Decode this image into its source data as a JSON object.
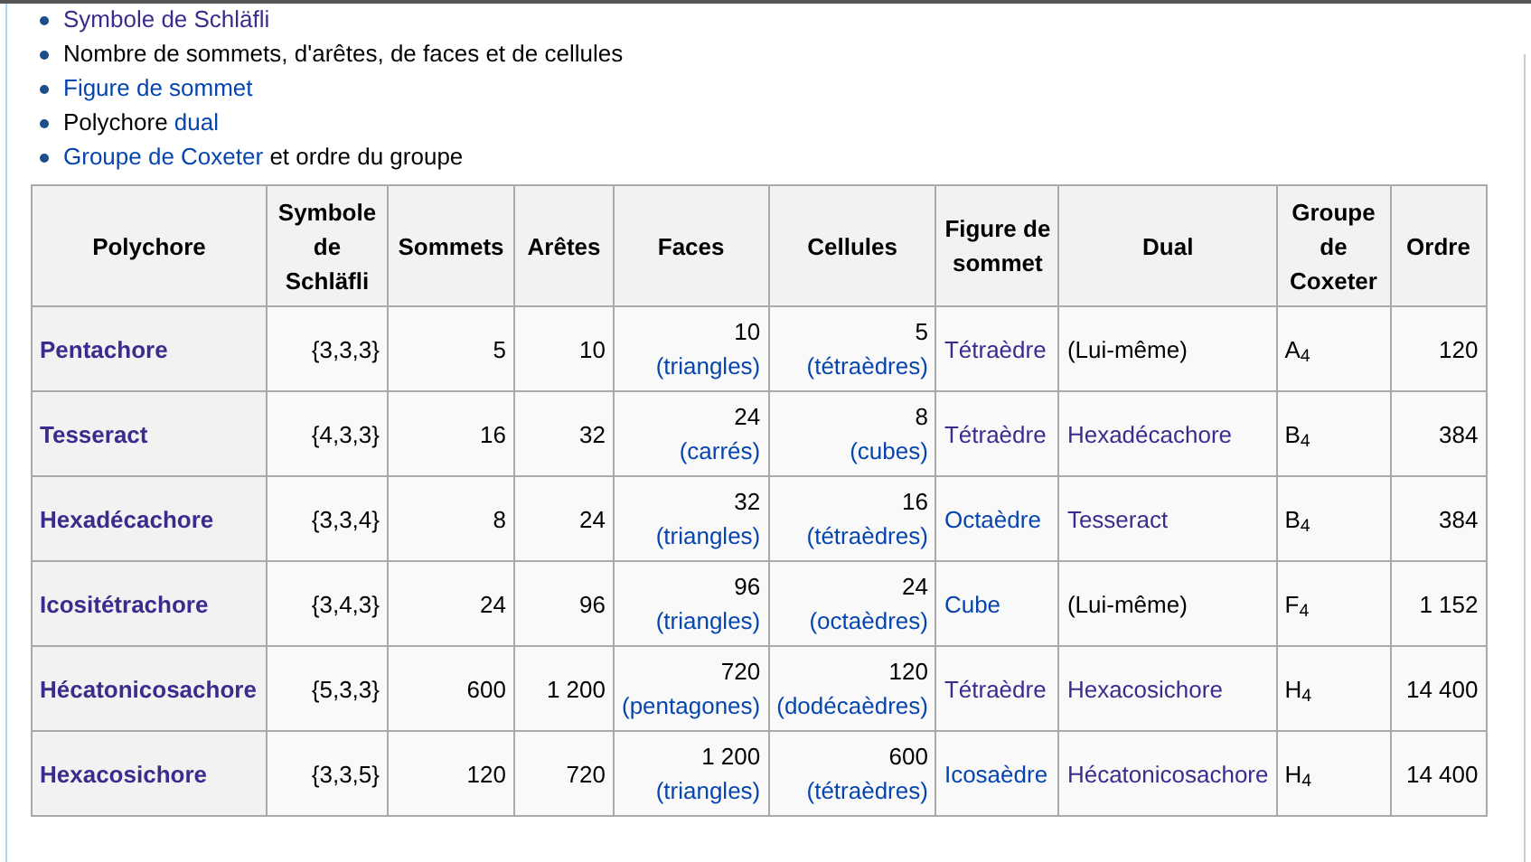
{
  "intro_list": [
    {
      "parts": [
        {
          "kind": "link",
          "text": "Symbole de Schläfli",
          "visited": true
        }
      ]
    },
    {
      "parts": [
        {
          "kind": "plain",
          "text": "Nombre de sommets, d'arêtes, de faces et de cellules"
        }
      ]
    },
    {
      "parts": [
        {
          "kind": "link",
          "text": "Figure de sommet",
          "visited": false
        }
      ]
    },
    {
      "parts": [
        {
          "kind": "plain",
          "text": "Polychore "
        },
        {
          "kind": "link",
          "text": "dual",
          "visited": false
        }
      ]
    },
    {
      "parts": [
        {
          "kind": "link",
          "text": "Groupe de Coxeter",
          "visited": false
        },
        {
          "kind": "plain",
          "text": " et ordre du groupe"
        }
      ]
    }
  ],
  "table": {
    "columns": [
      "Polychore",
      "Symbole de Schläfli",
      "Sommets",
      "Arêtes",
      "Faces",
      "Cellules",
      "Figure de sommet",
      "Dual",
      "Groupe de Coxeter",
      "Ordre"
    ],
    "rows": [
      {
        "polychore": {
          "text": "Pentachore",
          "visited": true
        },
        "schlafli": "{3,3,3}",
        "sommets": "5",
        "aretes": "10",
        "faces": {
          "count": "10",
          "shape": "(triangles)",
          "visited": false
        },
        "cellules": {
          "count": "5",
          "shape": "(tétraèdres)",
          "visited": false
        },
        "figure": {
          "text": "Tétraèdre",
          "visited": true
        },
        "dual": {
          "kind": "plain",
          "text": "(Lui-même)"
        },
        "coxeter": "A$_{4}$",
        "ordre": "120"
      },
      {
        "polychore": {
          "text": "Tesseract",
          "visited": true
        },
        "schlafli": "{4,3,3}",
        "sommets": "16",
        "aretes": "32",
        "faces": {
          "count": "24",
          "shape": "(carrés)",
          "visited": false
        },
        "cellules": {
          "count": "8",
          "shape": "(cubes)",
          "visited": false
        },
        "figure": {
          "text": "Tétraèdre",
          "visited": true
        },
        "dual": {
          "kind": "link",
          "text": "Hexadécachore",
          "visited": true
        },
        "coxeter": "B$_{4}$",
        "ordre": "384"
      },
      {
        "polychore": {
          "text": "Hexadécachore",
          "visited": true
        },
        "schlafli": "{3,3,4}",
        "sommets": "8",
        "aretes": "24",
        "faces": {
          "count": "32",
          "shape": "(triangles)",
          "visited": false
        },
        "cellules": {
          "count": "16",
          "shape": "(tétraèdres)",
          "visited": false
        },
        "figure": {
          "text": "Octaèdre",
          "visited": false
        },
        "dual": {
          "kind": "link",
          "text": "Tesseract",
          "visited": true
        },
        "coxeter": "B$_{4}$",
        "ordre": "384"
      },
      {
        "polychore": {
          "text": "Icositétrachore",
          "visited": true
        },
        "schlafli": "{3,4,3}",
        "sommets": "24",
        "aretes": "96",
        "faces": {
          "count": "96",
          "shape": "(triangles)",
          "visited": false
        },
        "cellules": {
          "count": "24",
          "shape": "(octaèdres)",
          "visited": false
        },
        "figure": {
          "text": "Cube",
          "visited": false
        },
        "dual": {
          "kind": "plain",
          "text": "(Lui-même)"
        },
        "coxeter": "F$_{4}$",
        "ordre": "1 152"
      },
      {
        "polychore": {
          "text": "Hécatonicosachore",
          "visited": true
        },
        "schlafli": "{5,3,3}",
        "sommets": "600",
        "aretes": "1 200",
        "faces": {
          "count": "720",
          "shape": "(pentagones)",
          "visited": false
        },
        "cellules": {
          "count": "120",
          "shape": "(dodécaèdres)",
          "visited": false
        },
        "figure": {
          "text": "Tétraèdre",
          "visited": true
        },
        "dual": {
          "kind": "link",
          "text": "Hexacosichore",
          "visited": true
        },
        "coxeter": "H$_{4}$",
        "ordre": "14 400"
      },
      {
        "polychore": {
          "text": "Hexacosichore",
          "visited": true
        },
        "schlafli": "{3,3,5}",
        "sommets": "120",
        "aretes": "720",
        "faces": {
          "count": "1 200",
          "shape": "(triangles)",
          "visited": false
        },
        "cellules": {
          "count": "600",
          "shape": "(tétraèdres)",
          "visited": false
        },
        "figure": {
          "text": "Icosaèdre",
          "visited": false
        },
        "dual": {
          "kind": "link",
          "text": "Hécatonicosachore",
          "visited": true
        },
        "coxeter": "H$_{4}$",
        "ordre": "14 400"
      }
    ]
  }
}
